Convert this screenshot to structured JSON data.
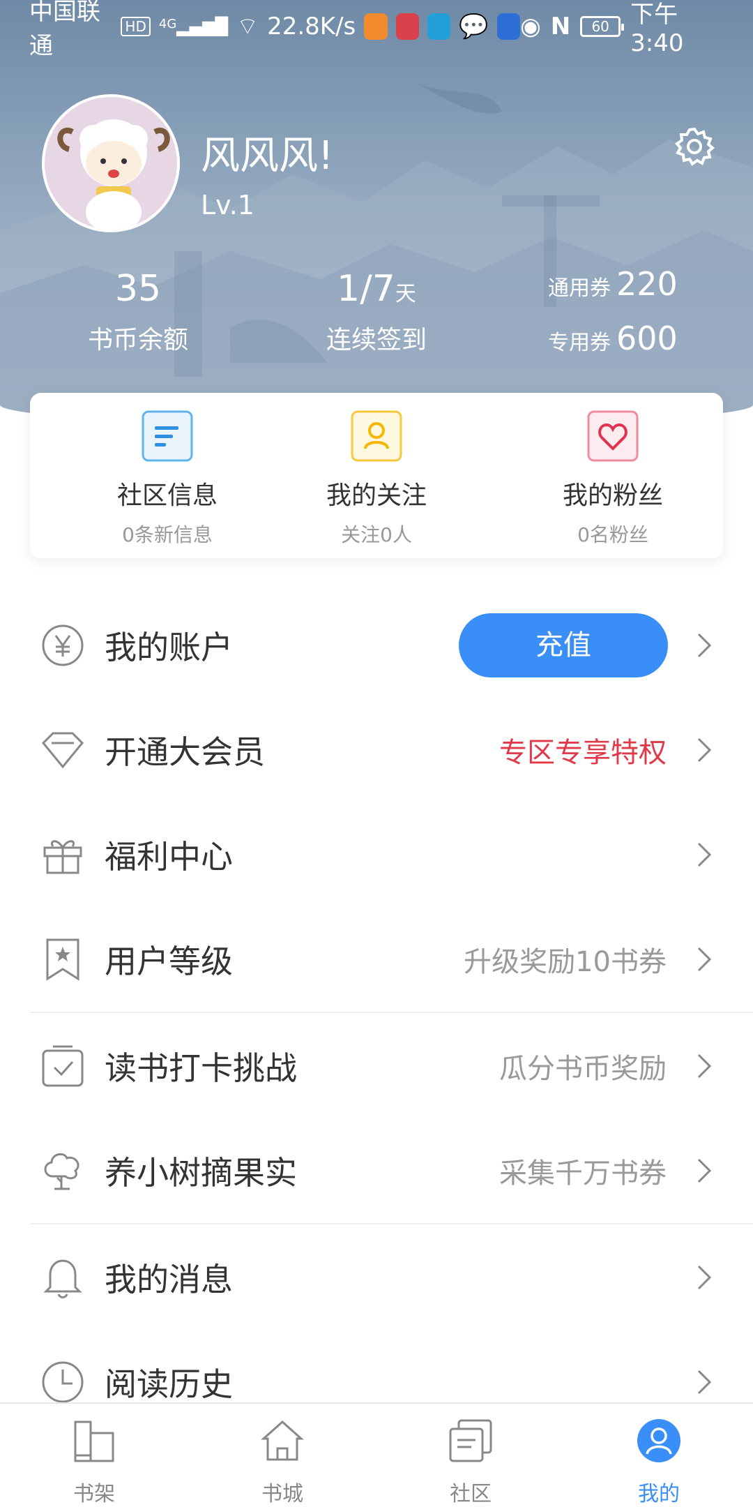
{
  "status_bar": {
    "carrier": "中国联通",
    "hd": "HD",
    "network": "4G",
    "speed": "22.8K/s",
    "battery": "60",
    "time": "下午3:40"
  },
  "profile": {
    "username": "风风风!",
    "level": "Lv.1"
  },
  "stats": {
    "coins_value": "35",
    "coins_label": "书币余额",
    "checkin_value": "1/7",
    "checkin_unit": "天",
    "checkin_label": "连续签到",
    "general_coupon_label": "通用券",
    "general_coupon_value": "220",
    "special_coupon_label": "专用券",
    "special_coupon_value": "600"
  },
  "card": [
    {
      "title": "社区信息",
      "sub": "0条新信息",
      "icon": "message-list-icon"
    },
    {
      "title": "我的关注",
      "sub": "关注0人",
      "icon": "person-icon"
    },
    {
      "title": "我的粉丝",
      "sub": "0名粉丝",
      "icon": "heart-icon"
    }
  ],
  "menu": {
    "account": {
      "label": "我的账户",
      "button": "充值"
    },
    "vip": {
      "label": "开通大会员",
      "extra": "专区专享特权"
    },
    "welfare": {
      "label": "福利中心"
    },
    "user_level": {
      "label": "用户等级",
      "extra": "升级奖励10书券"
    },
    "reading_challenge": {
      "label": "读书打卡挑战",
      "extra": "瓜分书币奖励"
    },
    "tree": {
      "label": "养小树摘果实",
      "extra": "采集千万书券"
    },
    "messages": {
      "label": "我的消息"
    },
    "history": {
      "label": "阅读历史"
    }
  },
  "tabs": [
    {
      "label": "书架",
      "icon": "bookshelf-icon"
    },
    {
      "label": "书城",
      "icon": "bookstore-home-icon"
    },
    {
      "label": "社区",
      "icon": "community-icon"
    },
    {
      "label": "我的",
      "icon": "profile-icon"
    }
  ],
  "colors": {
    "accent": "#3a8ef7",
    "vip_red": "#e03a4a",
    "muted": "#999999",
    "follow_yellow": "#f5b700",
    "fans_pink": "#e0334f"
  }
}
